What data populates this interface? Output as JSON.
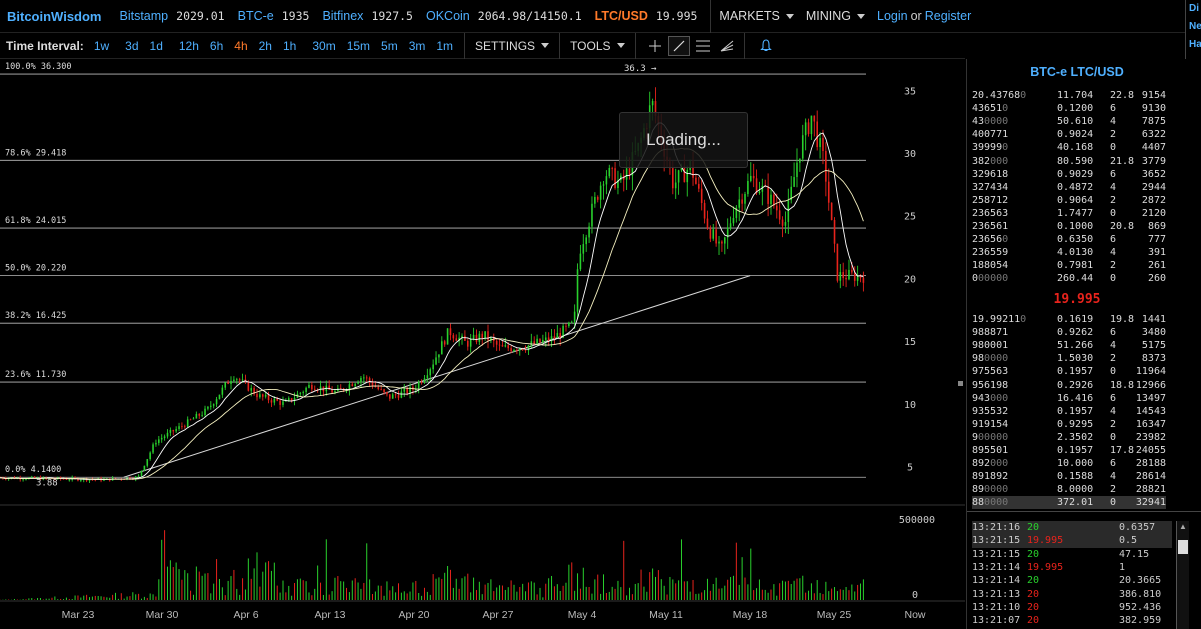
{
  "header": {
    "logo": "BitcoinWisdom",
    "markets": [
      {
        "name": "Bitstamp",
        "price": "2029.01",
        "highlight": false
      },
      {
        "name": "BTC-e",
        "price": "1935",
        "highlight": false
      },
      {
        "name": "Bitfinex",
        "price": "1927.5",
        "highlight": false
      },
      {
        "name": "OKCoin",
        "price": "2064.98/14150.1",
        "highlight": false
      },
      {
        "name": "LTC/USD",
        "price": "19.995",
        "highlight": true
      }
    ],
    "menus": [
      "MARKETS",
      "MINING"
    ],
    "login": "Login",
    "or": "or",
    "register": "Register",
    "right_stub": [
      "Di",
      "Ne",
      "Ha"
    ]
  },
  "toolbar": {
    "time_interval_label": "Time Interval:",
    "intervals": [
      "1w",
      "3d",
      "1d",
      "12h",
      "6h",
      "4h",
      "2h",
      "1h",
      "30m",
      "15m",
      "5m",
      "3m",
      "1m"
    ],
    "active_interval": "4h",
    "settings_label": "SETTINGS",
    "tools_label": "TOOLS",
    "drawing_tools": [
      "crosshair-icon",
      "line-tool-icon",
      "fib-tool-icon",
      "fan-tool-icon",
      "alarm-bell-icon"
    ]
  },
  "loading_text": "Loading...",
  "chart_data": {
    "type": "candlestick",
    "title": "",
    "x_ticks": [
      "Mar 23",
      "Mar 30",
      "Apr 6",
      "Apr 13",
      "Apr 20",
      "Apr 27",
      "May 4",
      "May 11",
      "May 18",
      "May 25",
      "Now"
    ],
    "y_ticks": [
      35,
      30,
      25,
      20,
      15,
      10,
      5
    ],
    "ylim": [
      3.2,
      37.5
    ],
    "volume_ticks": [
      "500000",
      "0"
    ],
    "volume_ylim": [
      0,
      800000
    ],
    "fib_levels": [
      {
        "label": "100.0% 36.300",
        "value": 36.3
      },
      {
        "label": "78.6% 29.418",
        "value": 29.418
      },
      {
        "label": "61.8% 24.015",
        "value": 24.015
      },
      {
        "label": "50.0% 20.220",
        "value": 20.22
      },
      {
        "label": "38.2% 16.425",
        "value": 16.425
      },
      {
        "label": "23.6% 11.730",
        "value": 11.73
      },
      {
        "label": "0.0% 4.1400",
        "value": 4.14
      }
    ],
    "annotations": [
      {
        "text": "36.3",
        "x": 0.685,
        "y": 36.3
      },
      {
        "text": "3.88",
        "x": 0.02,
        "y": 3.88
      }
    ],
    "trendline": [
      {
        "x": 0.16,
        "y": 4.14
      },
      {
        "x": 0.97,
        "y": 20.22
      }
    ],
    "price_path": [
      [
        0.0,
        4.1
      ],
      [
        0.04,
        4.05
      ],
      [
        0.08,
        4.0
      ],
      [
        0.12,
        3.95
      ],
      [
        0.16,
        4.14
      ],
      [
        0.18,
        7.0
      ],
      [
        0.21,
        8.2
      ],
      [
        0.24,
        9.5
      ],
      [
        0.27,
        12.3
      ],
      [
        0.3,
        10.6
      ],
      [
        0.33,
        10.0
      ],
      [
        0.36,
        11.5
      ],
      [
        0.39,
        10.9
      ],
      [
        0.42,
        12.2
      ],
      [
        0.45,
        10.5
      ],
      [
        0.48,
        11.2
      ],
      [
        0.5,
        13.1
      ],
      [
        0.52,
        15.8
      ],
      [
        0.54,
        14.8
      ],
      [
        0.56,
        15.5
      ],
      [
        0.58,
        14.4
      ],
      [
        0.61,
        14.6
      ],
      [
        0.64,
        15.2
      ],
      [
        0.665,
        16.4
      ],
      [
        0.67,
        22.0
      ],
      [
        0.7,
        28.5
      ],
      [
        0.72,
        27.5
      ],
      [
        0.74,
        30.5
      ],
      [
        0.755,
        34.0
      ],
      [
        0.77,
        30.2
      ],
      [
        0.78,
        27.5
      ],
      [
        0.8,
        29.0
      ],
      [
        0.82,
        24.2
      ],
      [
        0.835,
        22.0
      ],
      [
        0.85,
        25.5
      ],
      [
        0.87,
        28.0
      ],
      [
        0.89,
        26.5
      ],
      [
        0.91,
        24.5
      ],
      [
        0.925,
        30.0
      ],
      [
        0.94,
        33.0
      ],
      [
        0.955,
        29.0
      ],
      [
        0.97,
        20.2
      ]
    ],
    "volume_path": [
      [
        0.0,
        2000
      ],
      [
        0.18,
        80000
      ],
      [
        0.19,
        700000
      ],
      [
        0.21,
        300000
      ],
      [
        0.28,
        250000
      ],
      [
        0.29,
        650000
      ],
      [
        0.34,
        200000
      ],
      [
        0.37,
        230000
      ],
      [
        0.48,
        150000
      ],
      [
        0.51,
        300000
      ],
      [
        0.56,
        180000
      ],
      [
        0.63,
        150000
      ],
      [
        0.67,
        380000
      ],
      [
        0.68,
        230000
      ],
      [
        0.72,
        200000
      ],
      [
        0.75,
        300000
      ],
      [
        0.77,
        250000
      ],
      [
        0.82,
        180000
      ],
      [
        0.85,
        200000
      ],
      [
        0.9,
        160000
      ],
      [
        0.93,
        220000
      ],
      [
        0.96,
        180000
      ]
    ]
  },
  "orderbook": {
    "title": "BTC-e LTC/USD",
    "last_price": "19.995",
    "asks": [
      {
        "p": "20.43768",
        "pd": "0",
        "v": "11.704",
        "s": "22.8",
        "t": "9154"
      },
      {
        "p": "43651",
        "pd": "0",
        "v": "0.1200",
        "s": "6",
        "t": "9130"
      },
      {
        "p": "43",
        "pd": "0000",
        "v": "50.610",
        "s": "4",
        "t": "7875"
      },
      {
        "p": "400771",
        "pd": "",
        "v": "0.9024",
        "s": "2",
        "t": "6322"
      },
      {
        "p": "39999",
        "pd": "0",
        "v": "40.168",
        "s": "0",
        "t": "4407"
      },
      {
        "p": "382",
        "pd": "000",
        "v": "80.590",
        "s": "21.8",
        "t": "3779"
      },
      {
        "p": "329618",
        "pd": "",
        "v": "0.9029",
        "s": "6",
        "t": "3652"
      },
      {
        "p": "327434",
        "pd": "",
        "v": "0.4872",
        "s": "4",
        "t": "2944"
      },
      {
        "p": "258712",
        "pd": "",
        "v": "0.9064",
        "s": "2",
        "t": "2872"
      },
      {
        "p": "236563",
        "pd": "",
        "v": "1.7477",
        "s": "0",
        "t": "2120"
      },
      {
        "p": "236561",
        "pd": "",
        "v": "0.1000",
        "s": "20.8",
        "t": "869"
      },
      {
        "p": "23656",
        "pd": "0",
        "v": "0.6350",
        "s": "6",
        "t": "777"
      },
      {
        "p": "236559",
        "pd": "",
        "v": "4.0130",
        "s": "4",
        "t": "391"
      },
      {
        "p": "188054",
        "pd": "",
        "v": "0.7981",
        "s": "2",
        "t": "261"
      },
      {
        "p": "0",
        "pd": "00000",
        "v": "260.44",
        "s": "0",
        "t": "260"
      }
    ],
    "bids": [
      {
        "p": "19.99211",
        "pd": "0",
        "v": "0.1619",
        "s": "19.8",
        "t": "1441"
      },
      {
        "p": "988871",
        "pd": "",
        "v": "0.9262",
        "s": "6",
        "t": "3480"
      },
      {
        "p": "980001",
        "pd": "",
        "v": "51.266",
        "s": "4",
        "t": "5175"
      },
      {
        "p": "98",
        "pd": "0000",
        "v": "1.5030",
        "s": "2",
        "t": "8373"
      },
      {
        "p": "975563",
        "pd": "",
        "v": "0.1957",
        "s": "0",
        "t": "11964"
      },
      {
        "p": "956198",
        "pd": "",
        "v": "0.2926",
        "s": "18.8",
        "t": "12966"
      },
      {
        "p": "943",
        "pd": "000",
        "v": "16.416",
        "s": "6",
        "t": "13497"
      },
      {
        "p": "935532",
        "pd": "",
        "v": "0.1957",
        "s": "4",
        "t": "14543"
      },
      {
        "p": "919154",
        "pd": "",
        "v": "0.9295",
        "s": "2",
        "t": "16347"
      },
      {
        "p": "9",
        "pd": "00000",
        "v": "2.3502",
        "s": "0",
        "t": "23982"
      },
      {
        "p": "895501",
        "pd": "",
        "v": "0.1957",
        "s": "17.8",
        "t": "24055"
      },
      {
        "p": "892",
        "pd": "000",
        "v": "10.000",
        "s": "6",
        "t": "28188"
      },
      {
        "p": "891892",
        "pd": "",
        "v": "0.1588",
        "s": "4",
        "t": "28614"
      },
      {
        "p": "89",
        "pd": "0000",
        "v": "8.0000",
        "s": "2",
        "t": "28821"
      },
      {
        "p": "88",
        "pd": "0000",
        "v": "372.01",
        "s": "0",
        "t": "32941"
      }
    ]
  },
  "trades": [
    {
      "time": "13:21:16",
      "price": "20",
      "dir": "up",
      "amount": "0.6357"
    },
    {
      "time": "13:21:15",
      "price": "19.995",
      "dir": "dn",
      "amount": "0.5"
    },
    {
      "time": "13:21:15",
      "price": "20",
      "dir": "up",
      "amount": "47.15"
    },
    {
      "time": "13:21:14",
      "price": "19.995",
      "dir": "dn",
      "amount": "1"
    },
    {
      "time": "13:21:14",
      "price": "20",
      "dir": "up",
      "amount": "20.3665"
    },
    {
      "time": "13:21:13",
      "price": "20",
      "dir": "dn",
      "amount": "386.810"
    },
    {
      "time": "13:21:10",
      "price": "20",
      "dir": "dn",
      "amount": "952.436"
    },
    {
      "time": "13:21:07",
      "price": "20",
      "dir": "dn",
      "amount": "382.959"
    }
  ],
  "colors": {
    "accent": "#4fb0ff",
    "active": "#ff7a2a",
    "up": "#29d12d",
    "down": "#e8231c",
    "grid": "#bbbbbb",
    "ma": "#f5f0c0"
  }
}
